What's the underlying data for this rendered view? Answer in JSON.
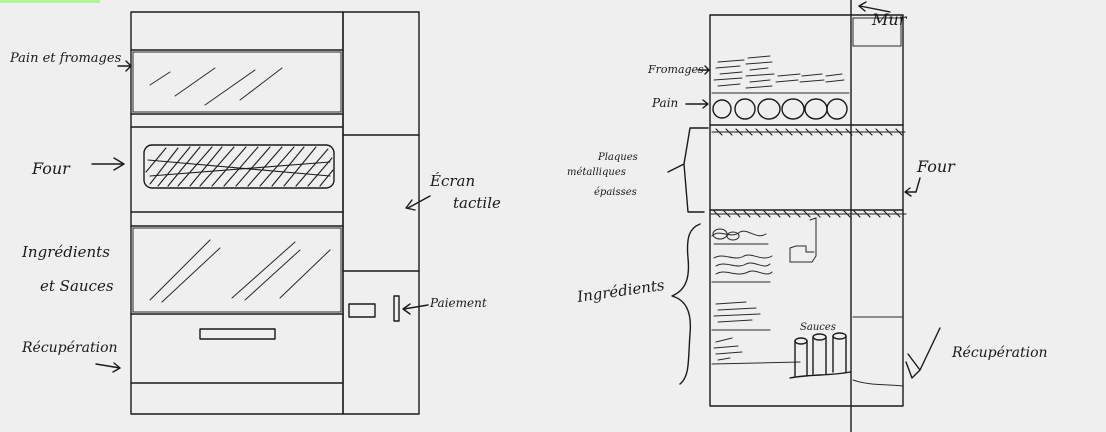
{
  "labels": {
    "pain_fromages": "Pain et fromages",
    "four_left": "Four",
    "ingredients_sauces_1": "Ingrédients",
    "ingredients_sauces_2": "et Sauces",
    "recuperation_left": "Récupération",
    "ecran_1": "Écran",
    "ecran_2": "tactile",
    "paiement": "Paiement",
    "mur": "Mur",
    "fromages": "Fromages",
    "pain": "Pain",
    "plaques_1": "Plaques",
    "plaques_2": "métalliques",
    "plaques_3": "épaisses",
    "four_right": "Four",
    "ingredients_right": "Ingrédients",
    "sauces": "Sauces",
    "recuperation_right": "Récupération"
  },
  "colors": {
    "background": "#efefef",
    "ink": "#1a1a1a",
    "accent_bar": "#b8f0a0"
  }
}
